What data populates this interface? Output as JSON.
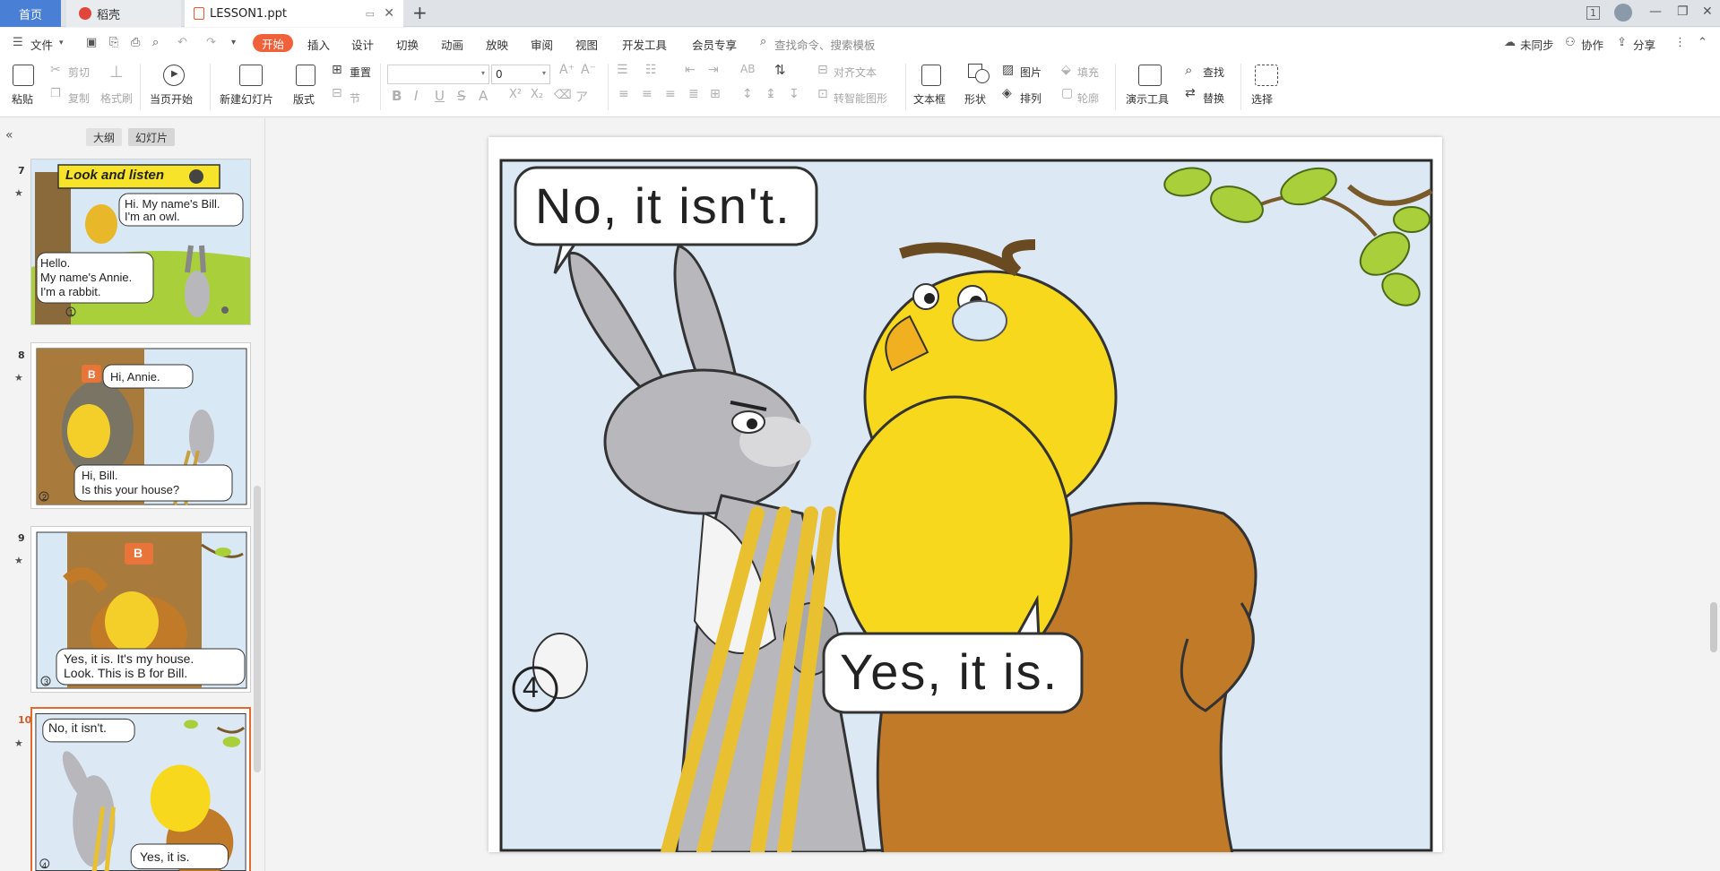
{
  "tabs": {
    "home": "首页",
    "daoke": "稻壳",
    "file": "LESSON1.ppt"
  },
  "menu": {
    "file": "文件",
    "items": [
      "开始",
      "插入",
      "设计",
      "切换",
      "动画",
      "放映",
      "审阅",
      "视图",
      "开发工具",
      "会员专享"
    ],
    "search_placeholder": "查找命令、搜索模板",
    "sync": "未同步",
    "collab": "协作",
    "share": "分享"
  },
  "ribbon": {
    "paste": "粘贴",
    "cut": "剪切",
    "copy": "复制",
    "format_painter": "格式刷",
    "from_start": "当页开始",
    "new_slide": "新建幻灯片",
    "layout": "版式",
    "reset": "重置",
    "section": "节",
    "font_size": "0",
    "align_text": "对齐文本",
    "smartart": "转智能图形",
    "textbox": "文本框",
    "shape": "形状",
    "picture": "图片",
    "arrange": "排列",
    "fill": "填充",
    "outline": "轮廓",
    "present_tools": "演示工具",
    "find": "查找",
    "replace": "替换",
    "select": "选择"
  },
  "leftpane": {
    "outline_tab": "大纲",
    "slides_tab": "幻灯片",
    "slides": [
      {
        "num": "7",
        "heading": "Look and listen",
        "lines": [
          "Hi. My name's Bill.",
          "I'm an owl.",
          "Hello.",
          "My name's Annie.",
          "I'm a rabbit."
        ],
        "page": "1"
      },
      {
        "num": "8",
        "lines": [
          "Hi, Annie.",
          "Hi, Bill.",
          "Is this your house?"
        ],
        "page": "2",
        "badge": "B"
      },
      {
        "num": "9",
        "lines": [
          "Yes, it is. It's my house.",
          "Look. This is B for Bill."
        ],
        "page": "3",
        "badge": "B"
      },
      {
        "num": "10",
        "lines": [
          "No, it isn't.",
          "Yes, it is."
        ],
        "page": "4"
      }
    ]
  },
  "slide": {
    "bubble_top": "No, it isn't.",
    "bubble_bottom": "Yes, it is.",
    "page_number": "4"
  },
  "colors": {
    "accent": "#f0613a",
    "home_tab": "#4a7fd6",
    "current_thumb_border": "#e26a2c",
    "sky": "#dce9f5",
    "rabbit": "#b8b8bc",
    "owl_yellow": "#f8d81c",
    "owl_brown": "#c07a28",
    "leaf": "#a9cf3a"
  }
}
